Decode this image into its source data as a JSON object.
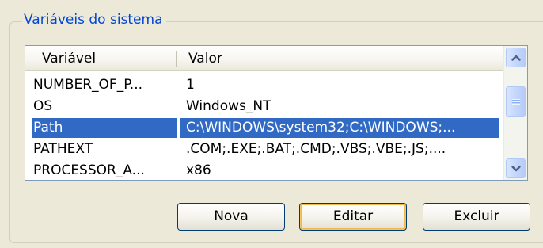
{
  "group": {
    "title": "Variáveis do sistema"
  },
  "list": {
    "columns": {
      "variable": "Variável",
      "value": "Valor"
    },
    "rows": [
      {
        "variable": "NUMBER_OF_P...",
        "value": "1",
        "selected": false
      },
      {
        "variable": "OS",
        "value": "Windows_NT",
        "selected": false
      },
      {
        "variable": "Path",
        "value": "C:\\WINDOWS\\system32;C:\\WINDOWS;...",
        "selected": true
      },
      {
        "variable": "PATHEXT",
        "value": ".COM;.EXE;.BAT;.CMD;.VBS;.VBE;.JS;....",
        "selected": false
      },
      {
        "variable": "PROCESSOR_A...",
        "value": "x86",
        "selected": false
      }
    ]
  },
  "scrollbar": {
    "up_icon": "arrow-up-icon",
    "down_icon": "arrow-down-icon",
    "thumb_grip_icon": "grip-icon"
  },
  "buttons": {
    "new_label": "Nova",
    "edit_label": "Editar",
    "delete_label": "Excluir"
  },
  "colors": {
    "selection": "#316ac5",
    "group_title": "#0046d5",
    "window_bg": "#ece9d8"
  }
}
